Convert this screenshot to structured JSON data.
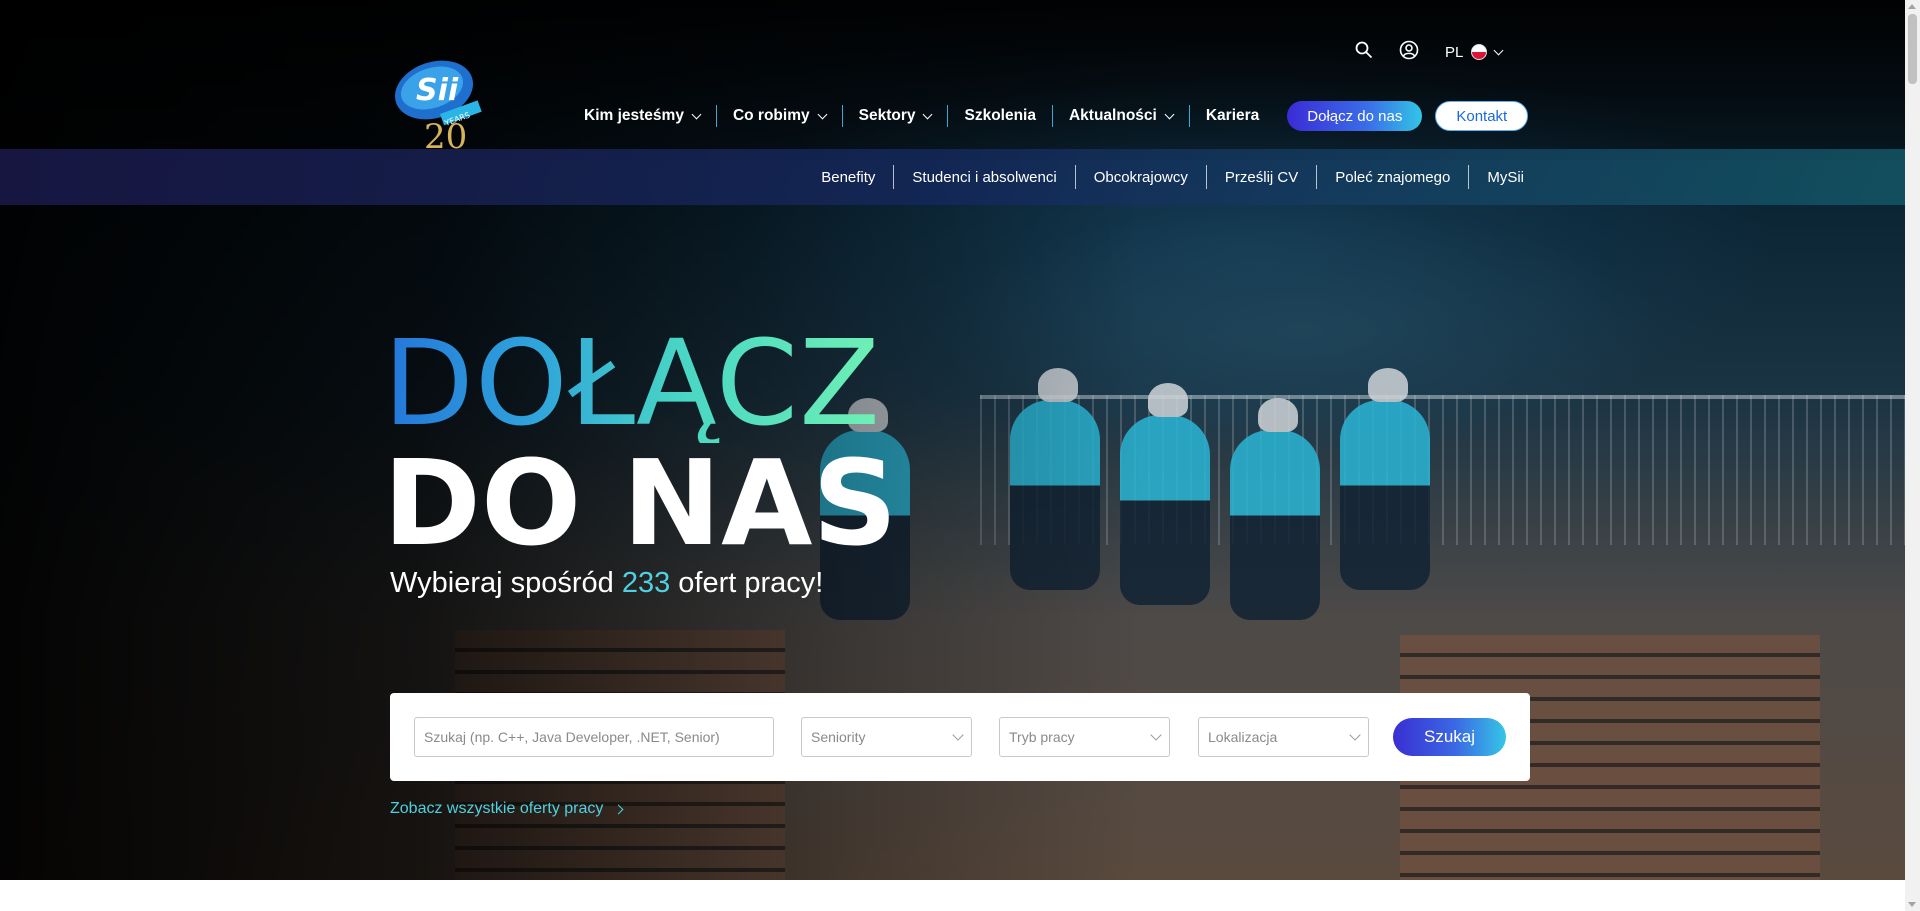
{
  "header": {
    "logo_alt": "Sii 20 YEARS",
    "logo_text": "Sii",
    "logo_badge": "YEARS",
    "logo_years": "20",
    "language": "PL",
    "nav": [
      {
        "label": "Kim jesteśmy",
        "has_dropdown": true
      },
      {
        "label": "Co robimy",
        "has_dropdown": true
      },
      {
        "label": "Sektory",
        "has_dropdown": true
      },
      {
        "label": "Szkolenia",
        "has_dropdown": false
      },
      {
        "label": "Aktualności",
        "has_dropdown": true
      },
      {
        "label": "Kariera",
        "has_dropdown": false
      }
    ],
    "join_label": "Dołącz do nas",
    "contact_label": "Kontakt"
  },
  "subnav": [
    "Benefity",
    "Studenci i absolwenci",
    "Obcokrajowcy",
    "Prześlij CV",
    "Poleć znajomego",
    "MySii"
  ],
  "hero": {
    "title_line1": "DOŁĄCZ",
    "title_line2": "DO NAS",
    "subtitle_prefix": "Wybieraj spośród",
    "offer_count": "233",
    "subtitle_suffix": "ofert pracy!"
  },
  "search": {
    "placeholder": "Szukaj (np. C++, Java Developer, .NET, Senior)",
    "seniority": "Seniority",
    "work_mode": "Tryb pracy",
    "location": "Lokalizacja",
    "button_label": "Szukaj",
    "all_offers_link": "Zobacz wszystkie oferty pracy"
  },
  "colors": {
    "accent_blue": "#3b2bd6",
    "accent_cyan": "#4fd0e0",
    "title_gradient_start": "#2476d9",
    "title_gradient_end": "#6ff0b4"
  }
}
